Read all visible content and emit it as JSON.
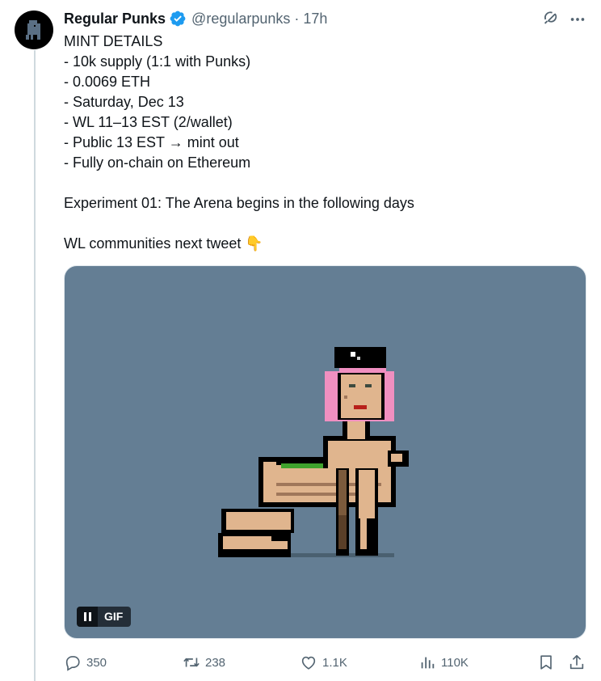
{
  "tweet": {
    "display_name": "Regular Punks",
    "handle": "@regularpunks",
    "separator": "·",
    "time": "17h",
    "lines": [
      "MINT DETAILS",
      "- 10k supply (1:1 with Punks)",
      "- 0.0069 ETH",
      "- Saturday, Dec 13",
      "- WL 11–13 EST (2/wallet)",
      "- Public 13 EST → mint out",
      "- Fully on-chain on Ethereum",
      "Experiment 01: The Arena begins in the following days",
      "WL communities next tweet 👇"
    ],
    "media": {
      "badge_label": "GIF",
      "background": "#647e94"
    }
  },
  "actions": {
    "replies": "350",
    "retweets": "238",
    "likes": "1.1K",
    "views": "110K"
  },
  "icons": {
    "verified": "verified-badge-icon",
    "grok": "grok-icon",
    "more": "more-icon",
    "reply": "reply-icon",
    "retweet": "retweet-icon",
    "like": "heart-icon",
    "views": "views-icon",
    "bookmark": "bookmark-icon",
    "share": "share-icon"
  },
  "colors": {
    "verified_blue": "#1d9bf0",
    "secondary_text": "#536471",
    "thread_line": "#cfd9de"
  }
}
